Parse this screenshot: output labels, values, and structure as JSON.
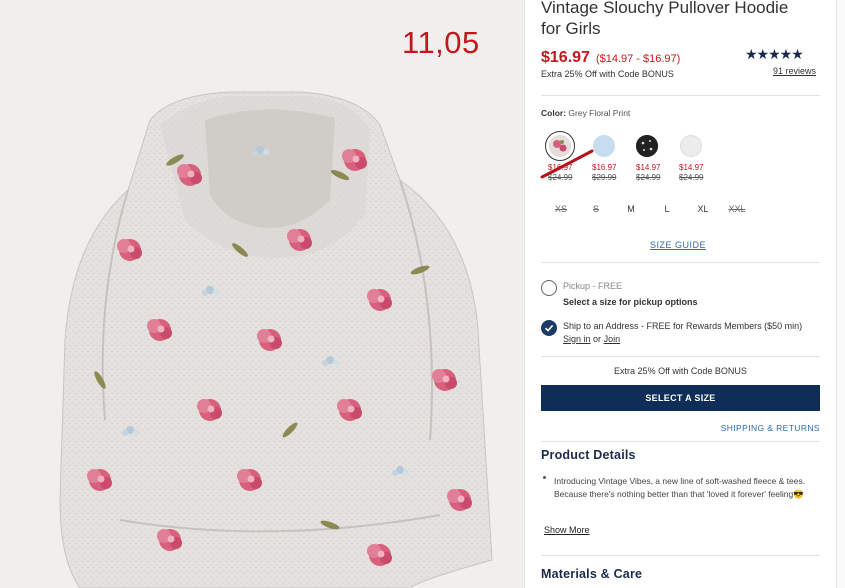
{
  "overlay": {
    "number": "11,05"
  },
  "product": {
    "title": "Vintage Slouchy Pullover Hoodie for Girls",
    "price": "$16.97",
    "price_range": "($14.97 - $16.97)",
    "promo": "Extra 25% Off with Code BONUS",
    "stars": "★★★★★",
    "reviews": "91 reviews"
  },
  "color": {
    "label": "Color:",
    "selected": "Grey Floral Print",
    "swatches": [
      {
        "price": "$16.97",
        "orig": "$24.99",
        "fill": "#e8b7c3"
      },
      {
        "price": "$16.97",
        "orig": "$29.99",
        "fill": "#c6ddef"
      },
      {
        "price": "$14.97",
        "orig": "$24.99",
        "fill": "#222222"
      },
      {
        "price": "$14.97",
        "orig": "$24.99",
        "fill": "#ececea"
      }
    ]
  },
  "sizes": [
    "XS",
    "S",
    "M",
    "L",
    "XL",
    "XXL"
  ],
  "size_guide": "SIZE GUIDE",
  "fulfillment": {
    "pickup_label": "Pickup - FREE",
    "pickup_note": "Select a size for pickup options",
    "ship_text": "Ship to an Address - FREE for Rewards Members ($50 min)",
    "sign_in": "Sign in",
    "or": "or",
    "join": "Join"
  },
  "extra_offer": "Extra 25% Off with Code BONUS",
  "select_button": "SELECT A SIZE",
  "shipping_returns": "SHIPPING & RETURNS",
  "details": {
    "heading": "Product Details",
    "bullet": "Introducing Vintage Vibes, a new line of soft-washed fleece & tees. Because there's nothing better than that 'loved it forever' feeling😎",
    "show_more": "Show More"
  },
  "materials": {
    "heading": "Materials & Care"
  },
  "colors": {
    "accent_red": "#c4171d",
    "navy": "#0e2e57",
    "link_blue": "#2a6bb1"
  }
}
